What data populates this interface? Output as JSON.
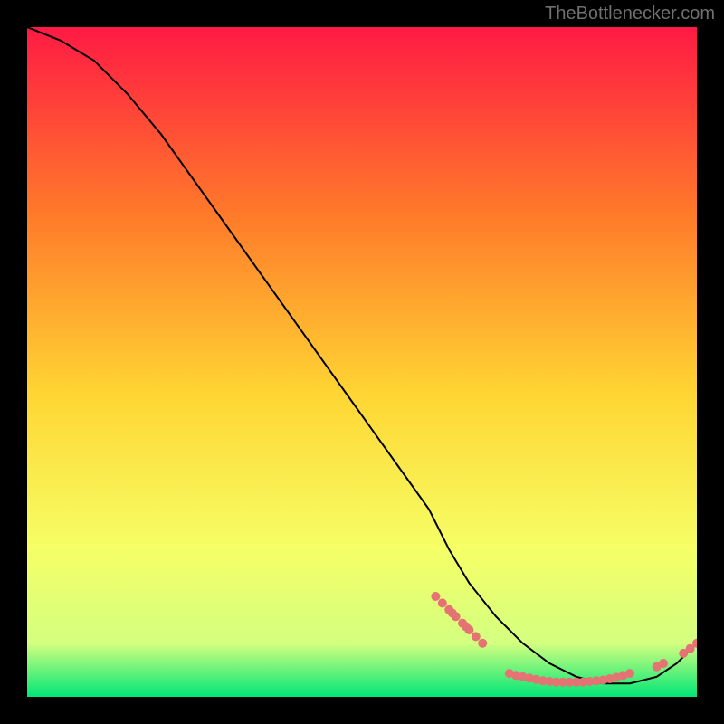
{
  "watermark": "TheBottlenecker.com",
  "chart_data": {
    "type": "line",
    "title": "",
    "xlabel": "",
    "ylabel": "",
    "xlim": [
      0,
      100
    ],
    "ylim": [
      0,
      100
    ],
    "background_gradient": {
      "top": "#ff1a44",
      "upper_mid": "#ff7a2a",
      "mid": "#ffd633",
      "lower_mid": "#f5ff66",
      "green_top": "#d4ff80",
      "green_bottom": "#00e676"
    },
    "series": [
      {
        "name": "curve",
        "type": "line",
        "stroke": "#000000",
        "x": [
          0,
          5,
          10,
          15,
          20,
          25,
          30,
          35,
          40,
          45,
          50,
          55,
          60,
          63,
          66,
          70,
          74,
          78,
          82,
          86,
          90,
          94,
          97,
          100
        ],
        "y": [
          100,
          98,
          95,
          90,
          84,
          77,
          70,
          63,
          56,
          49,
          42,
          35,
          28,
          22,
          17,
          12,
          8,
          5,
          3,
          2,
          2,
          3,
          5,
          8
        ]
      },
      {
        "name": "markers-left-cluster",
        "type": "scatter",
        "color": "#e57373",
        "x": [
          61,
          62,
          63,
          64,
          65,
          66,
          67,
          68,
          63.5,
          65.5
        ],
        "y": [
          15,
          14,
          13,
          12,
          11,
          10,
          9,
          8,
          12.5,
          10.5
        ]
      },
      {
        "name": "markers-bottom-band",
        "type": "scatter",
        "color": "#e57373",
        "x": [
          72,
          73,
          74,
          75,
          76,
          77,
          78,
          79,
          80,
          81,
          82,
          83,
          84,
          85,
          86,
          87,
          88,
          89,
          90
        ],
        "y": [
          3.5,
          3.2,
          3.0,
          2.8,
          2.6,
          2.4,
          2.3,
          2.2,
          2.2,
          2.2,
          2.2,
          2.2,
          2.3,
          2.4,
          2.5,
          2.7,
          2.9,
          3.2,
          3.5
        ]
      },
      {
        "name": "markers-right-cluster",
        "type": "scatter",
        "color": "#e57373",
        "x": [
          94,
          95,
          98,
          99,
          100
        ],
        "y": [
          4.5,
          5.0,
          6.5,
          7.2,
          8.0
        ]
      }
    ]
  }
}
